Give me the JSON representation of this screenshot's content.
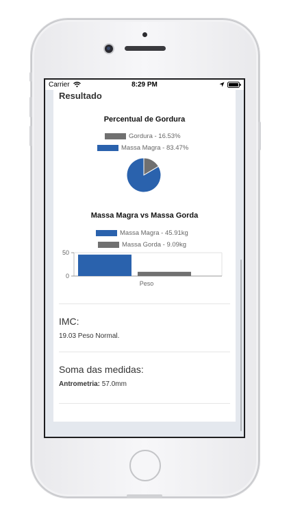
{
  "status_bar": {
    "carrier": "Carrier",
    "time": "8:29 PM"
  },
  "card": {
    "title": "Resultado"
  },
  "fat_chart": {
    "legend": [
      {
        "label": "Gordura - 16.53%",
        "color": "#707070"
      },
      {
        "label": "Massa Magra - 83.47%",
        "color": "#2a62ad"
      }
    ]
  },
  "mass_chart": {
    "legend": [
      {
        "label": "Massa Magra - 45.91kg",
        "color": "#2a62ad"
      },
      {
        "label": "Massa Gorda - 9.09kg",
        "color": "#707070"
      }
    ]
  },
  "chart_data": [
    {
      "type": "pie",
      "title": "Percentual de Gordura",
      "labels": [
        "Gordura",
        "Massa Magra"
      ],
      "values": [
        16.53,
        83.47
      ],
      "colors": [
        "#707070",
        "#2a62ad"
      ],
      "legend": "top"
    },
    {
      "type": "bar",
      "title": "Massa Magra vs Massa Gorda",
      "categories": [
        "Peso"
      ],
      "series": [
        {
          "name": "Massa Magra",
          "values": [
            45.91
          ],
          "color": "#2a62ad"
        },
        {
          "name": "Massa Gorda",
          "values": [
            9.09
          ],
          "color": "#707070"
        }
      ],
      "yticks": [
        "50",
        "0"
      ],
      "ylim": [
        0,
        50
      ],
      "grid": true,
      "legend": "top"
    }
  ],
  "imc": {
    "title": "IMC:",
    "text": "19.03 Peso Normal."
  },
  "medidas": {
    "title": "Soma das medidas:",
    "label": "Antrometria:",
    "value": "57.0mm"
  }
}
